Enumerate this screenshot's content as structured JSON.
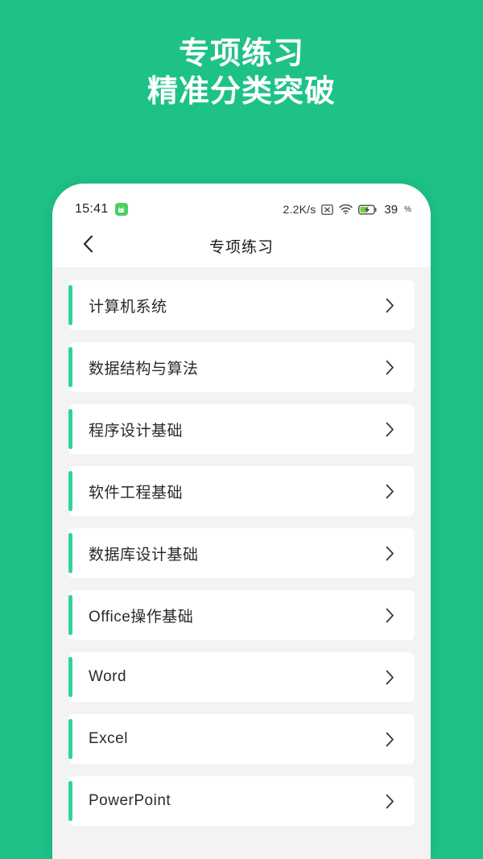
{
  "promo": {
    "line1": "专项练习",
    "line2": "精准分类突破",
    "background_color": "#1ec287",
    "text_color": "#ffffff"
  },
  "phone": {
    "statusbar": {
      "clock": "15:41",
      "app_icon": "android-robot-icon",
      "network_speed": "2.2K/s",
      "no_sim_icon": "boxed-x-icon",
      "wifi_icon": "wifi-icon",
      "battery_icon": "battery-charging-icon",
      "battery_level": "39",
      "battery_unit": "%",
      "battery_fill_color": "#6fd440"
    },
    "navbar": {
      "back_icon": "chevron-left-icon",
      "title": "专项练习"
    },
    "list": {
      "accent_color": "#2ed597",
      "background_color": "#f3f3f3",
      "chevron_icon": "chevron-right-icon",
      "items": [
        {
          "label": "计算机系统"
        },
        {
          "label": "数据结构与算法"
        },
        {
          "label": "程序设计基础"
        },
        {
          "label": "软件工程基础"
        },
        {
          "label": "数据库设计基础"
        },
        {
          "label": "Office操作基础"
        },
        {
          "label": "Word"
        },
        {
          "label": "Excel"
        },
        {
          "label": "PowerPoint"
        }
      ]
    }
  }
}
